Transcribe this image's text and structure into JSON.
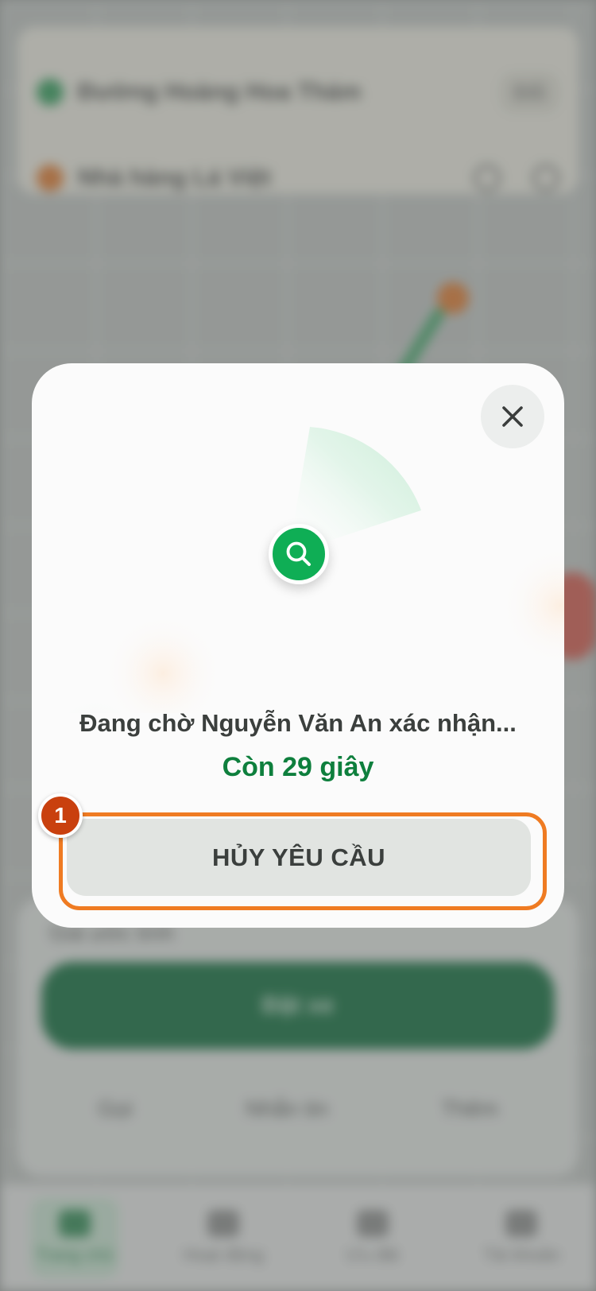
{
  "background": {
    "address_card": {
      "pickup_text": "Đường Hoàng Hoa Thám",
      "pickup_chip": "Đổi",
      "destination_text": "Nhà hàng Lá Việt"
    },
    "bottom_card": {
      "note": "Giá ước tính",
      "confirm_label": "Đặt xe",
      "actions": [
        "Gọi",
        "Nhắn tin",
        "Thêm"
      ]
    },
    "tabs": [
      {
        "label": "Trang chủ",
        "icon": "home-icon"
      },
      {
        "label": "Hoạt động",
        "icon": "activity-icon"
      },
      {
        "label": "Ưu đãi",
        "icon": "gift-icon"
      },
      {
        "label": "Tài khoản",
        "icon": "account-icon"
      }
    ]
  },
  "modal": {
    "waiting_text": "Đang chờ Nguyễn Văn An xác nhận...",
    "countdown_text": "Còn 29 giây",
    "cancel_label": "HỦY YÊU CẦU",
    "close_icon": "close-icon",
    "search_icon": "search-icon"
  },
  "annotation": {
    "step_number": "1"
  },
  "colors": {
    "accent_green": "#0fae55",
    "countdown_green": "#0e7f3d",
    "highlight_orange": "#ef7b22",
    "badge_red": "#c9400e"
  }
}
